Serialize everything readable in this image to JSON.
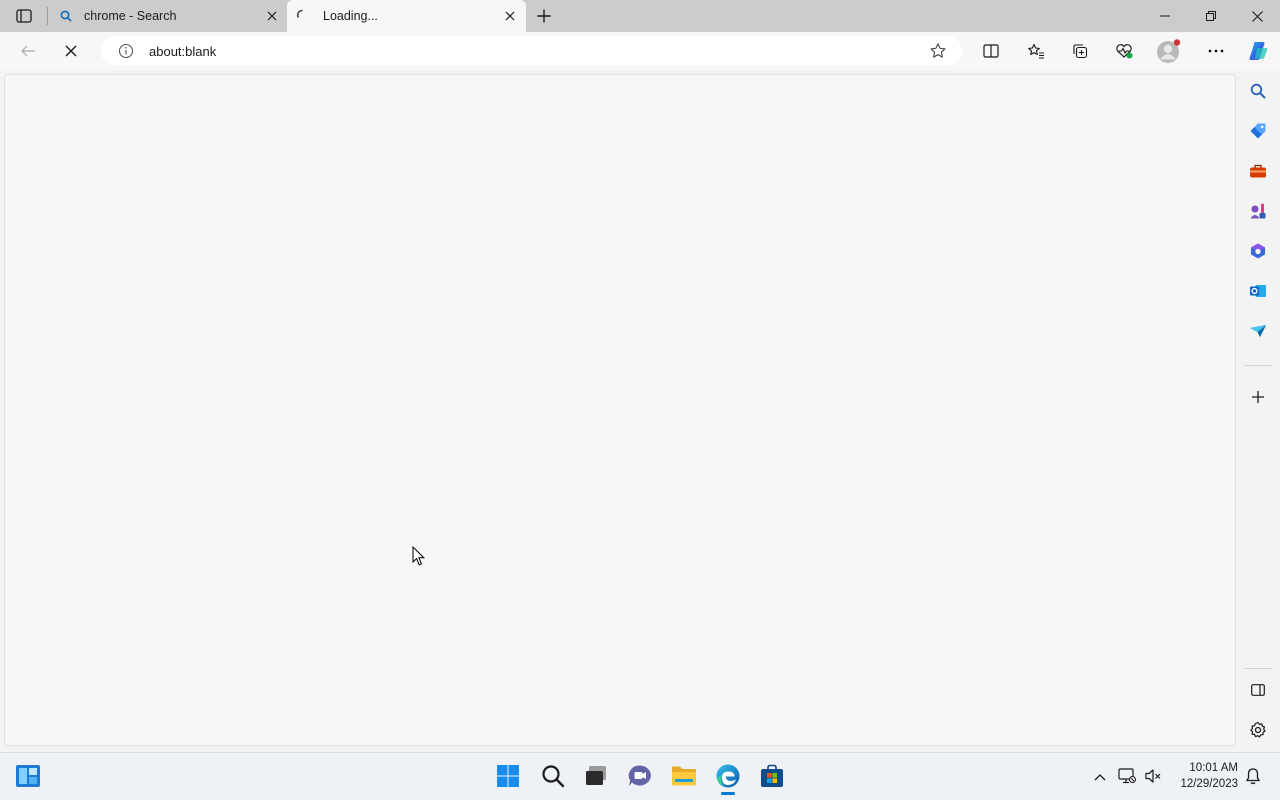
{
  "browser": {
    "tabs": [
      {
        "title": "chrome - Search",
        "icon": "search-icon",
        "active": false
      },
      {
        "title": "Loading...",
        "icon": "loading-spinner-icon",
        "active": true
      }
    ],
    "address_bar": {
      "url": "about:blank",
      "site_icon": "info-icon"
    },
    "toolbar_icons": [
      "back-arrow-icon",
      "stop-loading-icon",
      "favorite-star-icon",
      "split-screen-icon",
      "favorites-icon",
      "collections-icon",
      "browser-essentials-icon",
      "profile-avatar-icon",
      "more-icon",
      "copilot-icon"
    ],
    "sidebar_icons": [
      "search-icon",
      "shopping-tag-icon",
      "tools-icon",
      "games-icon",
      "microsoft365-icon",
      "outlook-icon",
      "drop-icon",
      "add-icon",
      "sidebar-toggle-icon",
      "settings-gear-icon"
    ]
  },
  "taskbar": {
    "apps": [
      "widgets-icon",
      "start-icon",
      "search-icon",
      "task-view-icon",
      "teams-chat-icon",
      "file-explorer-icon",
      "edge-icon",
      "store-icon"
    ],
    "tray_icons": [
      "chevron-up-icon",
      "network-icon",
      "volume-mute-icon"
    ],
    "time": "10:01 AM",
    "date": "12/29/2023"
  },
  "colors": {
    "accent": "#0078d4",
    "tabbar": "#cccccc",
    "taskbar": "#eef1f5"
  }
}
